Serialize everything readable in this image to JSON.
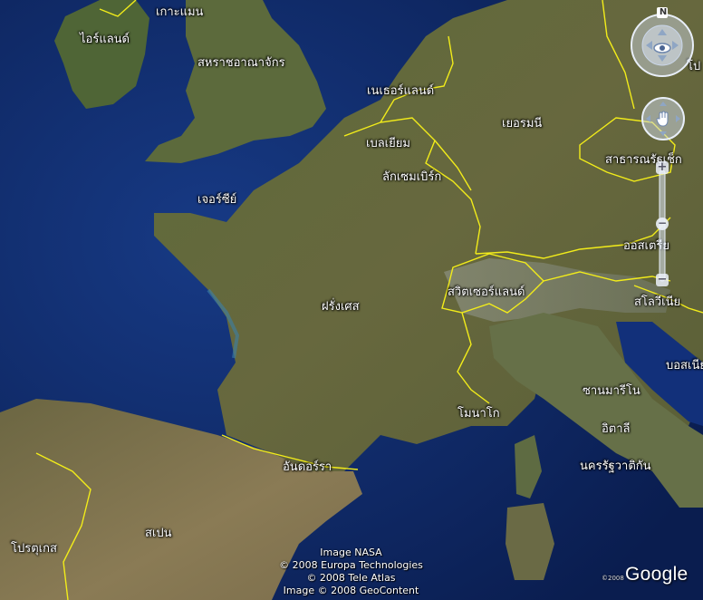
{
  "map": {
    "region": "Western Europe",
    "colors": {
      "ocean": "#0e2a6b",
      "land": "#5f6a3c",
      "border": "#f2ec1a",
      "label": "#ffffff"
    }
  },
  "labels": {
    "faroe": "เกาะแมน",
    "ireland": "ไอร์แลนด์",
    "uk": "สหราชอาณาจักร",
    "netherlands": "เนเธอร์แลนด์",
    "germany": "เยอรมนี",
    "belgium": "เบลเยียม",
    "luxembourg": "ลักเซมเบิร์ก",
    "czech": "สาธารณรัฐเช็ก",
    "jersey": "เจอร์ซีย์",
    "austria": "ออสเตรีย",
    "switzerland": "สวิตเซอร์แลนด์",
    "france": "ฝรั่งเศส",
    "slovenia": "สโลวีเนีย",
    "bosnia": "บอสเนีย",
    "sanmarino": "ซานมารีโน",
    "monaco": "โมนาโก",
    "italy": "อิตาลี",
    "vatican": "นครรัฐวาติกัน",
    "andorra": "อันดอร์รา",
    "spain": "สเปน",
    "portugal": "โปรตุเกส",
    "poland_partial": "โป"
  },
  "credits": {
    "line1": "Image NASA",
    "line2": "© 2008 Europa Technologies",
    "line3": "© 2008 Tele Atlas",
    "line4": "Image © 2008 GeoContent"
  },
  "logo": {
    "text": "Google",
    "copyright": "©2008"
  },
  "controls": {
    "north": "N",
    "zoom_in": "+",
    "zoom_out": "−",
    "look_icon": "eye-icon",
    "move_icon": "hand-icon"
  }
}
